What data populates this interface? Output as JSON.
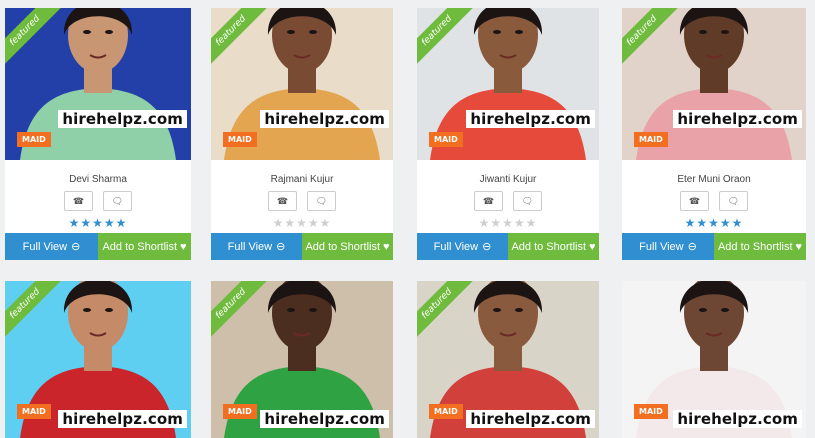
{
  "colors": {
    "featured": "#6fbb3d",
    "maid": "#f26f21",
    "full_view": "#2f8fd0",
    "shortlist": "#6fbb3d",
    "star_on": "#2f8fd0",
    "star_off": "#cfcfcf"
  },
  "ui": {
    "full_view": "Full View",
    "shortlist": "Add to Shortlist",
    "featured": "featured",
    "watermark": "hirehelpz.com",
    "badge": "MAID",
    "icons": {
      "phone": "phone-icon",
      "chat": "chat-icon",
      "full": "arrow-circle-icon",
      "heart": "heart-icon"
    }
  },
  "row1": [
    {
      "name": "Devi Sharma",
      "rating": 5,
      "featured": true,
      "bg": "#233fa8",
      "skin": "#c99673",
      "shirt": "#8fd0a8"
    },
    {
      "name": "Rajmani Kujur",
      "rating": 0,
      "featured": true,
      "bg": "#e9dcc9",
      "skin": "#7a4b33",
      "shirt": "#e3a54f"
    },
    {
      "name": "Jiwanti Kujur",
      "rating": 0,
      "featured": true,
      "bg": "#dfe3e6",
      "skin": "#8a5a3d",
      "shirt": "#e64a3b"
    },
    {
      "name": "Eter Muni Oraon",
      "rating": 5,
      "featured": true,
      "bg": "#e2d3ca",
      "skin": "#5f3b28",
      "shirt": "#e9a3a8"
    }
  ],
  "row2": [
    {
      "featured": true,
      "bg": "#5ecff0",
      "skin": "#c58a68",
      "shirt": "#c9252b"
    },
    {
      "featured": true,
      "bg": "#cdbfa9",
      "skin": "#4b2e20",
      "shirt": "#2fa344"
    },
    {
      "featured": true,
      "bg": "#d9d4c8",
      "skin": "#8a5a3f",
      "shirt": "#d1403b"
    },
    {
      "featured": false,
      "bg": "#f4f4f4",
      "skin": "#6e4634",
      "shirt": "#f3e9ea"
    }
  ]
}
